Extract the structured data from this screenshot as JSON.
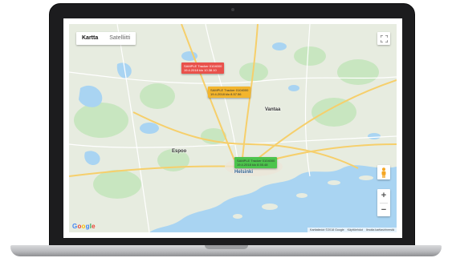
{
  "map": {
    "type_control": {
      "map_label": "Kartta",
      "satellite_label": "Satelliitti"
    },
    "fullscreen_icon": "fullscreen-icon",
    "pegman_icon": "pegman-icon",
    "zoom": {
      "in_label": "+",
      "out_label": "−"
    },
    "google_logo": "Google",
    "attribution": [
      "Karttatiedot ©2018 Google",
      "Käyttöehdot",
      "Ilmoita karttavirheestä"
    ],
    "places": [
      {
        "name": "Espoo"
      },
      {
        "name": "Vantaa"
      },
      {
        "name": "Helsinki"
      }
    ],
    "markers": [
      {
        "line1": "SAMPLE Tracker 0104000",
        "line2": "19.4.2018 klo 10.38.10",
        "color": "#e9514b"
      },
      {
        "line1": "SAMPLE Tracker 0104000",
        "line2": "19.4.2018 klo 8.57.56",
        "color": "#f3b52c"
      },
      {
        "line1": "SAMPLE Tracker 0104000",
        "line2": "19.4.2018 klo 8.55.48",
        "color": "#4cc44c"
      }
    ],
    "colors": {
      "water": "#a9d4f2",
      "land": "#e7ece0",
      "forest": "#c8e6c0",
      "major_road": "#f6cf6b"
    }
  }
}
